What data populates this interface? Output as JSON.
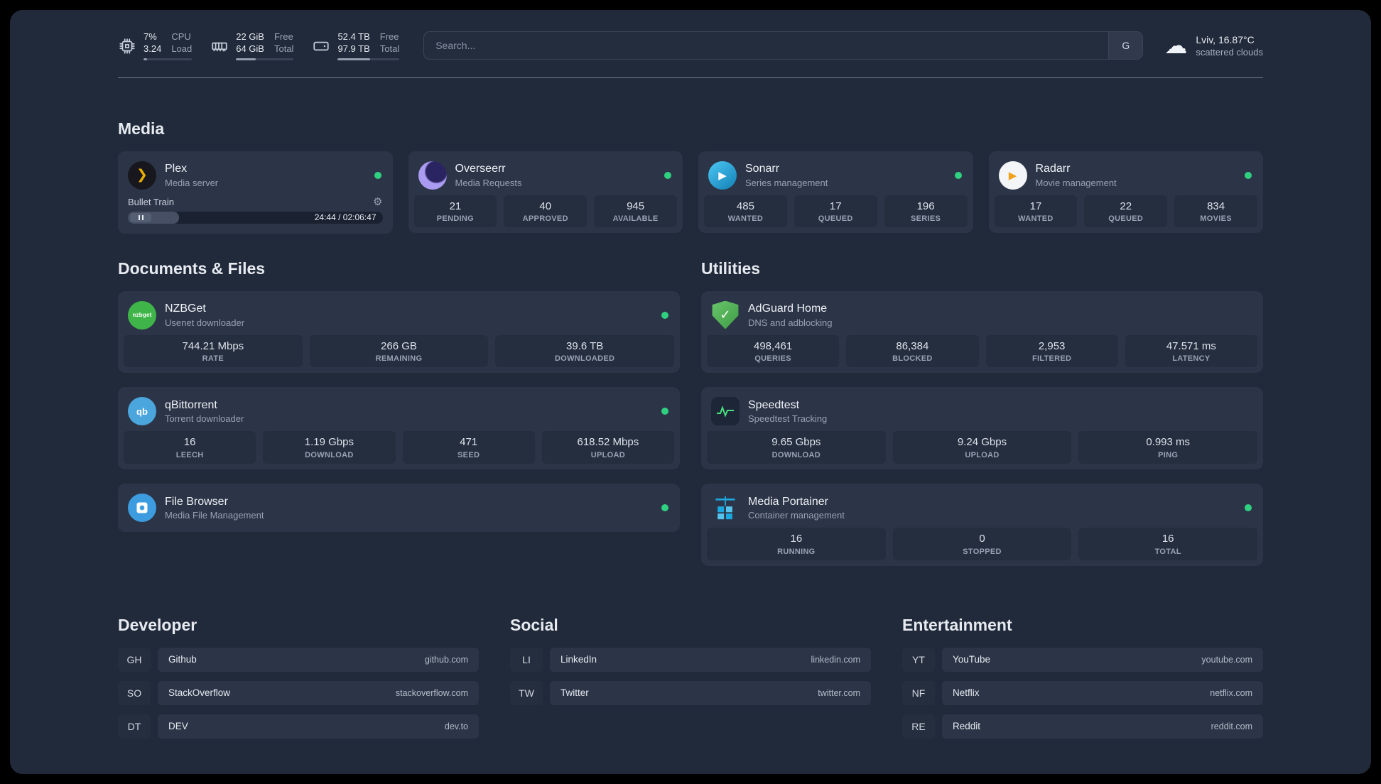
{
  "topbar": {
    "cpu": {
      "value_top": "7%",
      "value_bottom": "3.24",
      "label_top": "CPU",
      "label_bottom": "Load",
      "bar_pct": 8
    },
    "memory": {
      "value_top": "22 GiB",
      "value_bottom": "64 GiB",
      "label_top": "Free",
      "label_bottom": "Total",
      "bar_pct": 34
    },
    "disk": {
      "value_top": "52.4 TB",
      "value_bottom": "97.9 TB",
      "label_top": "Free",
      "label_bottom": "Total",
      "bar_pct": 53
    },
    "search_placeholder": "Search...",
    "search_provider": "G",
    "weather_location": "Lviv, 16.87°C",
    "weather_condition": "scattered clouds"
  },
  "media": {
    "title": "Media",
    "plex": {
      "name": "Plex",
      "desc": "Media server",
      "now_playing": "Bullet Train",
      "time": "24:44 / 02:06:47",
      "progress_pct": 20
    },
    "overseerr": {
      "name": "Overseerr",
      "desc": "Media Requests",
      "stats": [
        {
          "value": "21",
          "label": "PENDING"
        },
        {
          "value": "40",
          "label": "APPROVED"
        },
        {
          "value": "945",
          "label": "AVAILABLE"
        }
      ]
    },
    "sonarr": {
      "name": "Sonarr",
      "desc": "Series management",
      "stats": [
        {
          "value": "485",
          "label": "WANTED"
        },
        {
          "value": "17",
          "label": "QUEUED"
        },
        {
          "value": "196",
          "label": "SERIES"
        }
      ]
    },
    "radarr": {
      "name": "Radarr",
      "desc": "Movie management",
      "stats": [
        {
          "value": "17",
          "label": "WANTED"
        },
        {
          "value": "22",
          "label": "QUEUED"
        },
        {
          "value": "834",
          "label": "MOVIES"
        }
      ]
    }
  },
  "documents": {
    "title": "Documents & Files",
    "nzbget": {
      "name": "NZBGet",
      "desc": "Usenet downloader",
      "icon_text": "nzbget",
      "stats": [
        {
          "value": "744.21 Mbps",
          "label": "RATE"
        },
        {
          "value": "266 GB",
          "label": "REMAINING"
        },
        {
          "value": "39.6 TB",
          "label": "DOWNLOADED"
        }
      ]
    },
    "qbittorrent": {
      "name": "qBittorrent",
      "desc": "Torrent downloader",
      "icon_text": "qb",
      "stats": [
        {
          "value": "16",
          "label": "LEECH"
        },
        {
          "value": "1.19 Gbps",
          "label": "DOWNLOAD"
        },
        {
          "value": "471",
          "label": "SEED"
        },
        {
          "value": "618.52 Mbps",
          "label": "UPLOAD"
        }
      ]
    },
    "filebrowser": {
      "name": "File Browser",
      "desc": "Media File Management"
    }
  },
  "utilities": {
    "title": "Utilities",
    "adguard": {
      "name": "AdGuard Home",
      "desc": "DNS and adblocking",
      "stats": [
        {
          "value": "498,461",
          "label": "QUERIES"
        },
        {
          "value": "86,384",
          "label": "BLOCKED"
        },
        {
          "value": "2,953",
          "label": "FILTERED"
        },
        {
          "value": "47.571 ms",
          "label": "LATENCY"
        }
      ]
    },
    "speedtest": {
      "name": "Speedtest",
      "desc": "Speedtest Tracking",
      "stats": [
        {
          "value": "9.65 Gbps",
          "label": "DOWNLOAD"
        },
        {
          "value": "9.24 Gbps",
          "label": "UPLOAD"
        },
        {
          "value": "0.993 ms",
          "label": "PING"
        }
      ]
    },
    "portainer": {
      "name": "Media Portainer",
      "desc": "Container management",
      "stats": [
        {
          "value": "16",
          "label": "RUNNING"
        },
        {
          "value": "0",
          "label": "STOPPED"
        },
        {
          "value": "16",
          "label": "TOTAL"
        }
      ]
    }
  },
  "bookmarks": {
    "developer": {
      "title": "Developer",
      "items": [
        {
          "abbr": "GH",
          "name": "Github",
          "url": "github.com"
        },
        {
          "abbr": "SO",
          "name": "StackOverflow",
          "url": "stackoverflow.com"
        },
        {
          "abbr": "DT",
          "name": "DEV",
          "url": "dev.to"
        }
      ]
    },
    "social": {
      "title": "Social",
      "items": [
        {
          "abbr": "LI",
          "name": "LinkedIn",
          "url": "linkedin.com"
        },
        {
          "abbr": "TW",
          "name": "Twitter",
          "url": "twitter.com"
        }
      ]
    },
    "entertainment": {
      "title": "Entertainment",
      "items": [
        {
          "abbr": "YT",
          "name": "YouTube",
          "url": "youtube.com"
        },
        {
          "abbr": "NF",
          "name": "Netflix",
          "url": "netflix.com"
        },
        {
          "abbr": "RE",
          "name": "Reddit",
          "url": "reddit.com"
        }
      ]
    }
  }
}
